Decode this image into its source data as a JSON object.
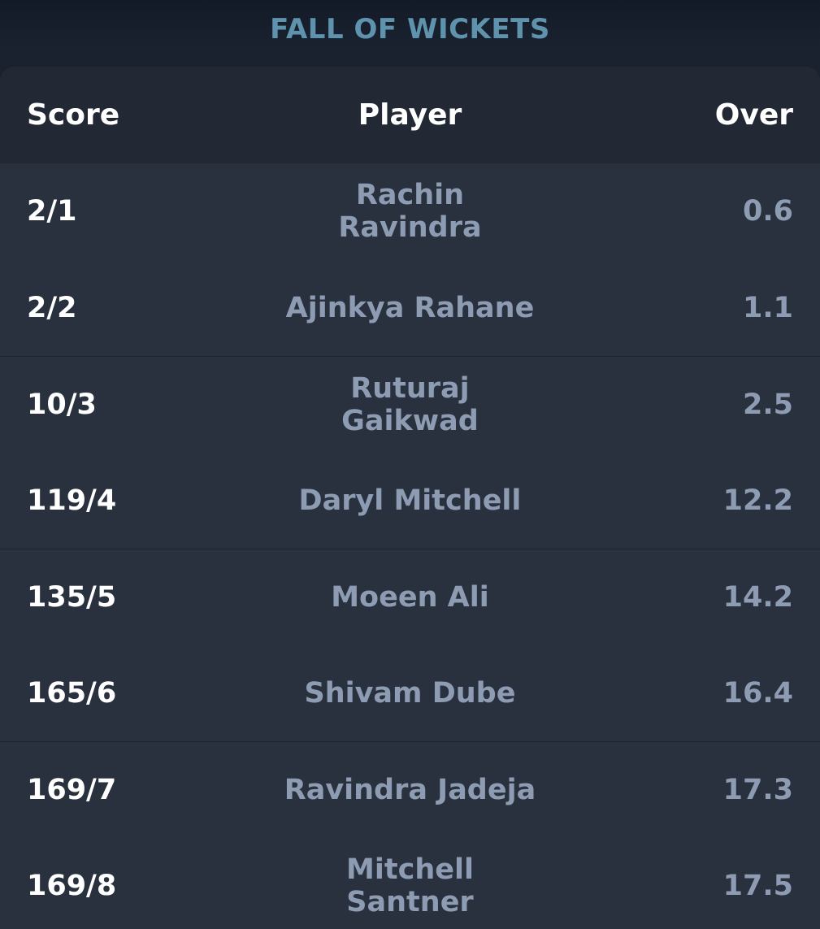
{
  "title": "FALL OF WICKETS",
  "columns": {
    "score": "Score",
    "player": "Player",
    "over": "Over"
  },
  "rows": [
    {
      "score": "2/1",
      "player": "Rachin Ravindra",
      "over": "0.6"
    },
    {
      "score": "2/2",
      "player": "Ajinkya Rahane",
      "over": "1.1"
    },
    {
      "score": "10/3",
      "player": "Ruturaj Gaikwad",
      "over": "2.5"
    },
    {
      "score": "119/4",
      "player": "Daryl Mitchell",
      "over": "12.2"
    },
    {
      "score": "135/5",
      "player": "Moeen Ali",
      "over": "14.2"
    },
    {
      "score": "165/6",
      "player": "Shivam Dube",
      "over": "16.4"
    },
    {
      "score": "169/7",
      "player": "Ravindra Jadeja",
      "over": "17.3"
    },
    {
      "score": "169/8",
      "player": "Mitchell Santner",
      "over": "17.5"
    }
  ],
  "colors": {
    "title": "#5f93ad",
    "header_bg": "#222935",
    "row_bg": "#29313e",
    "score_text": "#ffffff",
    "muted_text": "#8e9cb3"
  }
}
